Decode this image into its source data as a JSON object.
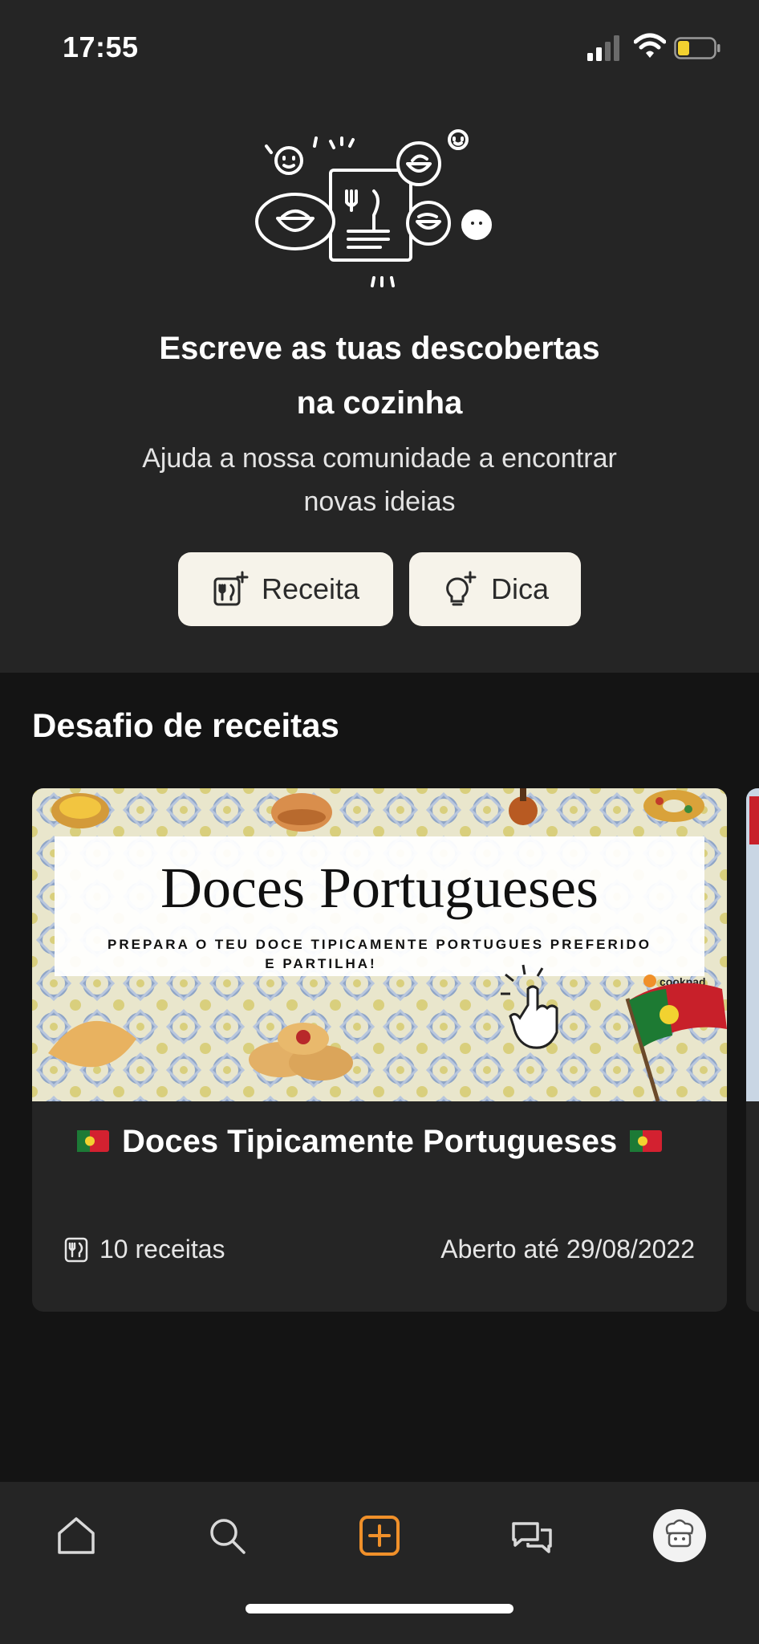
{
  "status_bar": {
    "time": "17:55"
  },
  "hero": {
    "title": "Escreve as tuas descobertas\nna cozinha",
    "subtitle": "Ajuda a nossa comunidade a encontrar\nnovas ideias",
    "recipe_button": {
      "label": "Receita",
      "icon": "recipe-add-icon"
    },
    "tip_button": {
      "label": "Dica",
      "icon": "lightbulb-add-icon"
    }
  },
  "challenges": {
    "section_title": "Desafio de receitas",
    "card": {
      "banner": {
        "heading": "Doces Portugueses",
        "subheading_line1": "PREPARA O TEU DOCE TIPICAMENTE PORTUGUES PREFERIDO",
        "subheading_line2": "E PARTILHA!",
        "brand": "cookpad"
      },
      "title": "Doces Tipicamente Portugueses",
      "recipes_count": "10 receitas",
      "open_until": "Aberto até 29/08/2022"
    }
  },
  "bottom_nav": {
    "items": [
      {
        "icon": "home-icon"
      },
      {
        "icon": "search-icon"
      },
      {
        "icon": "add-icon",
        "active": true
      },
      {
        "icon": "chat-icon"
      },
      {
        "icon": "profile-avatar"
      }
    ]
  },
  "colors": {
    "accent": "#f0902a",
    "surface": "#252525",
    "background": "#141414",
    "button_bg": "#f6f3ea"
  }
}
